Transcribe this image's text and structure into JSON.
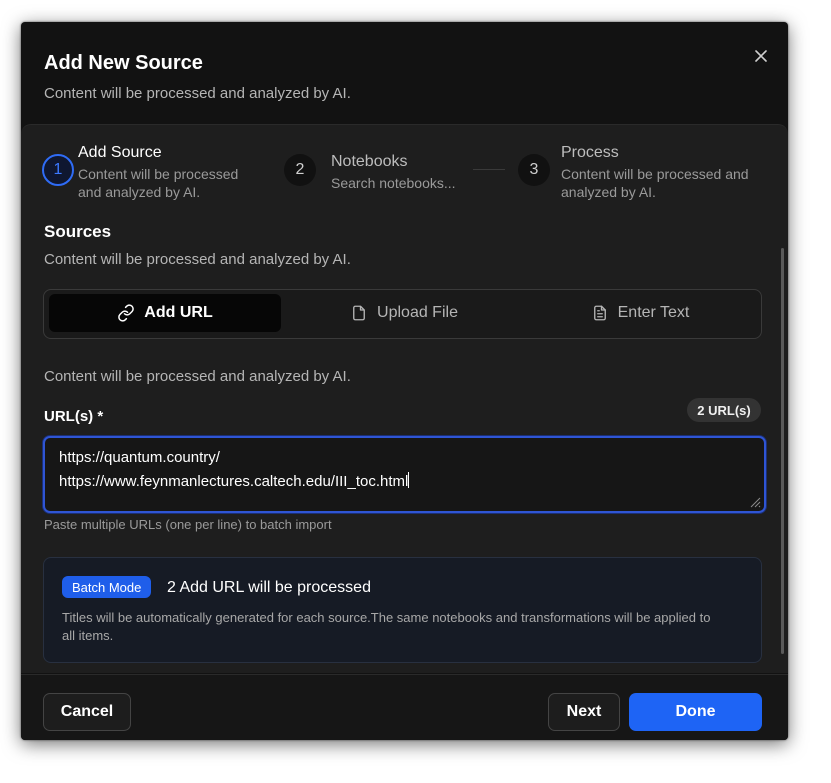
{
  "dialog": {
    "title": "Add New Source",
    "subtitle": "Content will be processed and analyzed by AI."
  },
  "steps": [
    {
      "number": "1",
      "title": "Add Source",
      "desc_line1": "Content will be processed",
      "desc_line2": "and analyzed by AI."
    },
    {
      "number": "2",
      "title": "Notebooks",
      "desc_line1": "Search notebooks..."
    },
    {
      "number": "3",
      "title": "Process",
      "desc_line1": "Content will be processed and",
      "desc_line2": "analyzed by AI."
    }
  ],
  "sources": {
    "title": "Sources",
    "desc": "Content will be processed and analyzed by AI.",
    "tabs": [
      {
        "label": "Add URL",
        "icon": "link-icon",
        "active": true
      },
      {
        "label": "Upload File",
        "icon": "file-icon",
        "active": false
      },
      {
        "label": "Enter Text",
        "icon": "document-text-icon",
        "active": false
      }
    ],
    "info": "Content will be processed and analyzed by AI."
  },
  "url_input": {
    "label": "URL(s) *",
    "count_badge": "2 URL(s)",
    "lines": [
      "https://quantum.country/",
      "https://www.feynmanlectures.caltech.edu/III_toc.html"
    ],
    "hint": "Paste multiple URLs (one per line) to batch import"
  },
  "batch": {
    "badge": "Batch Mode",
    "title": "2 Add URL will be processed",
    "desc": "Titles will be automatically generated for each source.The same notebooks and transformations will be applied to all items."
  },
  "footer": {
    "cancel": "Cancel",
    "next": "Next",
    "done": "Done"
  },
  "colors": {
    "accent": "#1e64f5",
    "background": "#121212",
    "panel": "#1e1e1e"
  }
}
